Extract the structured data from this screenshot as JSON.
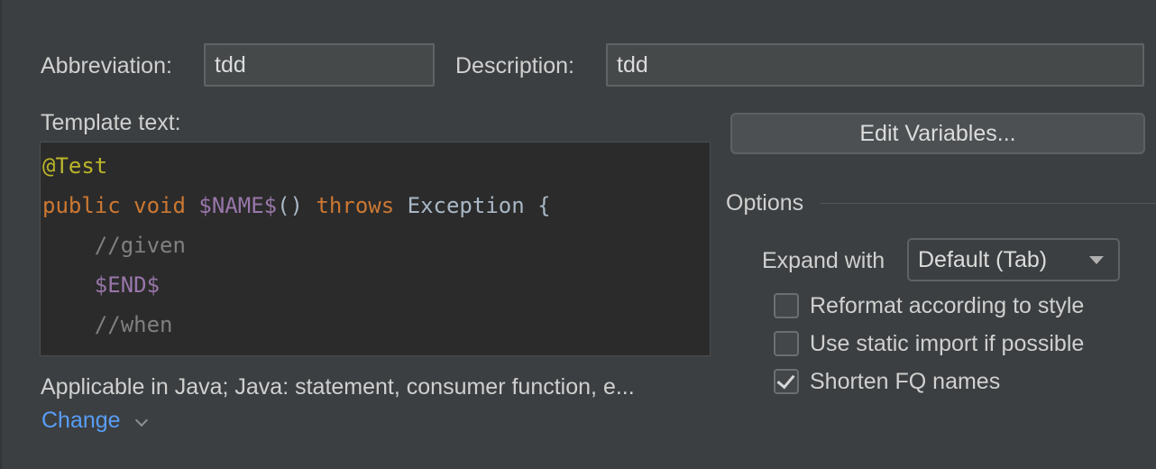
{
  "form": {
    "abbreviation_label": "Abbreviation:",
    "abbreviation_value": "tdd",
    "description_label": "Description:",
    "description_value": "tdd",
    "template_text_label": "Template text:",
    "applicable_text": "Applicable in Java; Java: statement, consumer function, e...",
    "change_link": "Change"
  },
  "editor": {
    "lines": [
      [
        {
          "text": "@Test",
          "kind": "ann"
        }
      ],
      [
        {
          "text": "public",
          "kind": "kw"
        },
        {
          "text": " ",
          "kind": "plain"
        },
        {
          "text": "void",
          "kind": "kw"
        },
        {
          "text": " ",
          "kind": "plain"
        },
        {
          "text": "$NAME$",
          "kind": "var"
        },
        {
          "text": "() ",
          "kind": "plain"
        },
        {
          "text": "throws",
          "kind": "kw"
        },
        {
          "text": " Exception {",
          "kind": "plain"
        }
      ],
      [
        {
          "text": "    //given",
          "kind": "cmt"
        }
      ],
      [
        {
          "text": "    ",
          "kind": "plain"
        },
        {
          "text": "$END$",
          "kind": "var"
        }
      ],
      [
        {
          "text": "    //when",
          "kind": "cmt"
        }
      ]
    ]
  },
  "options": {
    "edit_variables_button": "Edit Variables...",
    "section_title": "Options",
    "expand_with_label": "Expand with",
    "expand_with_value": "Default (Tab)",
    "checkboxes": [
      {
        "label": "Reformat according to style",
        "checked": false
      },
      {
        "label": "Use static import if possible",
        "checked": false
      },
      {
        "label": "Shorten FQ names",
        "checked": true
      }
    ]
  },
  "icons": {
    "combo_arrow": "chevron-down-icon",
    "change_chevron": "chevron-down-icon",
    "checkmark": "check-icon"
  },
  "colors": {
    "background": "#3c3f41",
    "editor_background": "#2b2b2b",
    "keyword": "#cc7832",
    "template_variable": "#9876aa",
    "annotation": "#bbb529",
    "comment": "#808080",
    "link": "#589df6"
  }
}
